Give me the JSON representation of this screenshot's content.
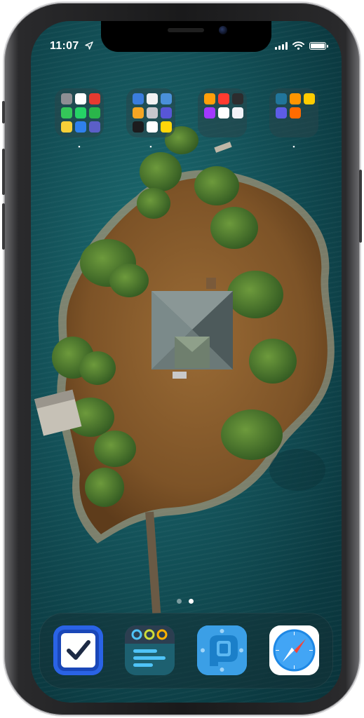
{
  "status_bar": {
    "time": "11:07",
    "location_icon": "location-arrow-icon",
    "signal_icon": "cellular-signal-icon",
    "wifi_icon": "wifi-icon",
    "battery_icon": "battery-icon",
    "battery_level": 1.0
  },
  "wallpaper": {
    "description_colors": {
      "water": "#135158",
      "land": "#8a5a2c",
      "trees": "#3e6b2a"
    }
  },
  "folders": [
    {
      "label": "▪",
      "apps": [
        {
          "icon": "settings-gear-icon",
          "color": "#8e8e93"
        },
        {
          "icon": "calendar-icon",
          "color": "#ffffff"
        },
        {
          "icon": "search-q-app-icon",
          "color": "#e63a30"
        },
        {
          "icon": "phone-icon",
          "color": "#34c759"
        },
        {
          "icon": "whatsapp-icon",
          "color": "#25d366"
        },
        {
          "icon": "wechat-icon",
          "color": "#2ab54a"
        },
        {
          "icon": "clock-ring-icon",
          "color": "#f7d038"
        },
        {
          "icon": "mail-icon",
          "color": "#2f80ed"
        },
        {
          "icon": "teams-icon",
          "color": "#5b5fc7"
        }
      ]
    },
    {
      "label": "▪",
      "apps": [
        {
          "icon": "grid-app-icon",
          "color": "#3b7ddd"
        },
        {
          "icon": "notes-white-icon",
          "color": "#f2f2f2"
        },
        {
          "icon": "table-app-icon",
          "color": "#4a90d9"
        },
        {
          "icon": "multicolor-grid-icon",
          "color": "#f5a623"
        },
        {
          "icon": "camera-icon",
          "color": "#c7c7cc"
        },
        {
          "icon": "layers-icon",
          "color": "#5856d6"
        },
        {
          "icon": "ia-writer-icon",
          "color": "#1c1c1e"
        },
        {
          "icon": "notion-icon",
          "color": "#ffffff"
        },
        {
          "icon": "sticky-note-icon",
          "color": "#ffd60a"
        }
      ]
    },
    {
      "label": "",
      "apps": [
        {
          "icon": "photos-icon",
          "color": "#ff9f0a"
        },
        {
          "icon": "red-app-icon",
          "color": "#ff3b30"
        },
        {
          "icon": "halide-icon",
          "color": "#2c2c2e"
        },
        {
          "icon": "picsart-p-icon",
          "color": "#a238ff"
        },
        {
          "icon": "feather-icon",
          "color": "#ffffff"
        },
        {
          "icon": "pencil-sketch-icon",
          "color": "#f2f2f7"
        }
      ]
    },
    {
      "label": "▪",
      "apps": [
        {
          "icon": "wordpress-icon",
          "color": "#21759b"
        },
        {
          "icon": "stack-icon",
          "color": "#ff9500"
        },
        {
          "icon": "bell-icon",
          "color": "#ffcc00"
        },
        {
          "icon": "overcast-icon",
          "color": "#5e5ce6"
        },
        {
          "icon": "orange-o-icon",
          "color": "#ff6b00"
        }
      ]
    }
  ],
  "page_indicator": {
    "count": 2,
    "active_index": 1
  },
  "dock": [
    {
      "icon": "things-checkbox-icon"
    },
    {
      "icon": "drafts-dots-icon"
    },
    {
      "icon": "tweetbot-bird-icon"
    },
    {
      "icon": "safari-compass-icon"
    }
  ]
}
